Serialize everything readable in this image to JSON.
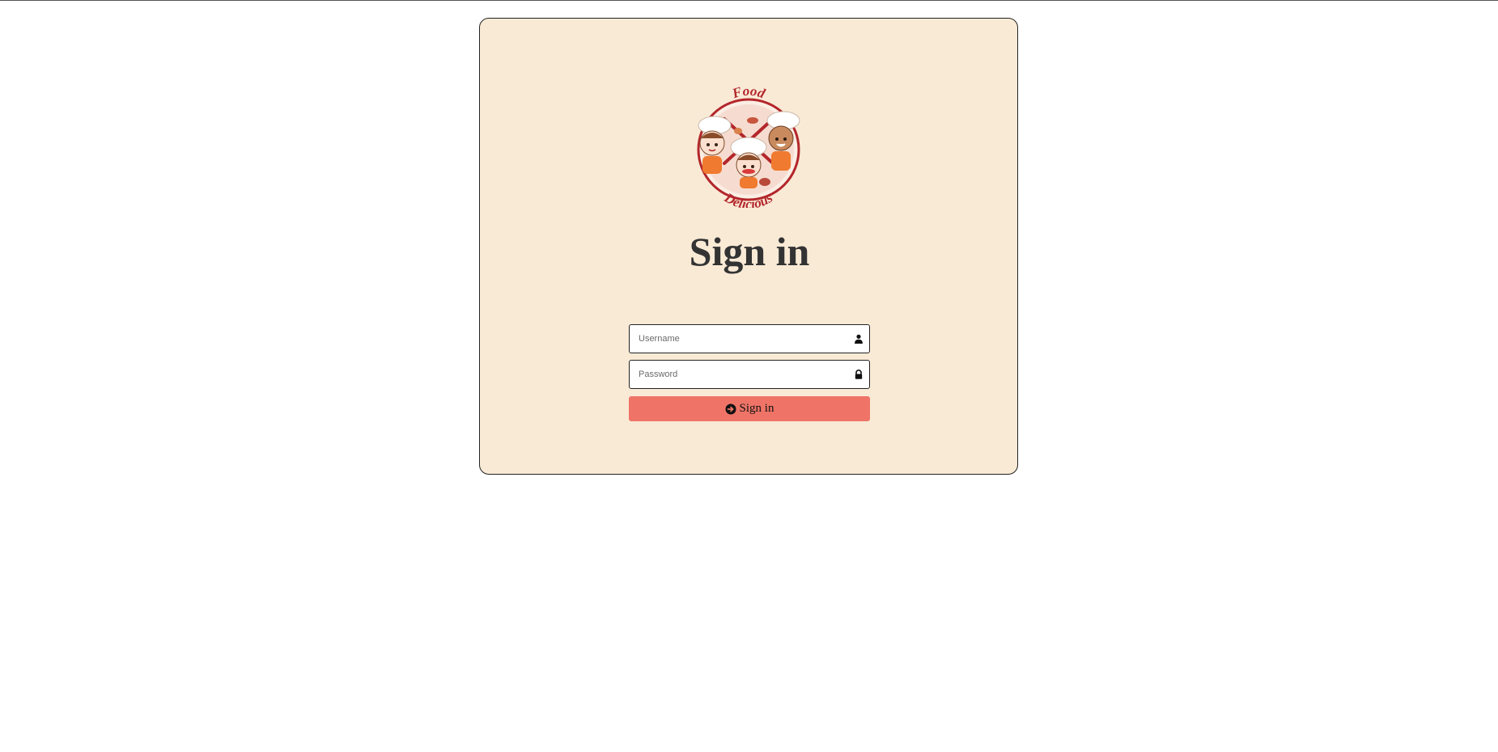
{
  "logo": {
    "text_top": "Food",
    "text_bottom": "Delicious",
    "icon": "chef-kids-logo"
  },
  "heading": "Sign in",
  "form": {
    "username": {
      "placeholder": "Username",
      "value": "",
      "icon": "user-icon"
    },
    "password": {
      "placeholder": "Password",
      "value": "",
      "icon": "lock-icon"
    },
    "submit": {
      "label": "Sign in",
      "icon": "arrow-circle-right-icon"
    }
  },
  "colors": {
    "card_background": "#f9ead6",
    "button": "#ef7467",
    "heading_text": "#333333",
    "logo_red": "#b3262b"
  }
}
